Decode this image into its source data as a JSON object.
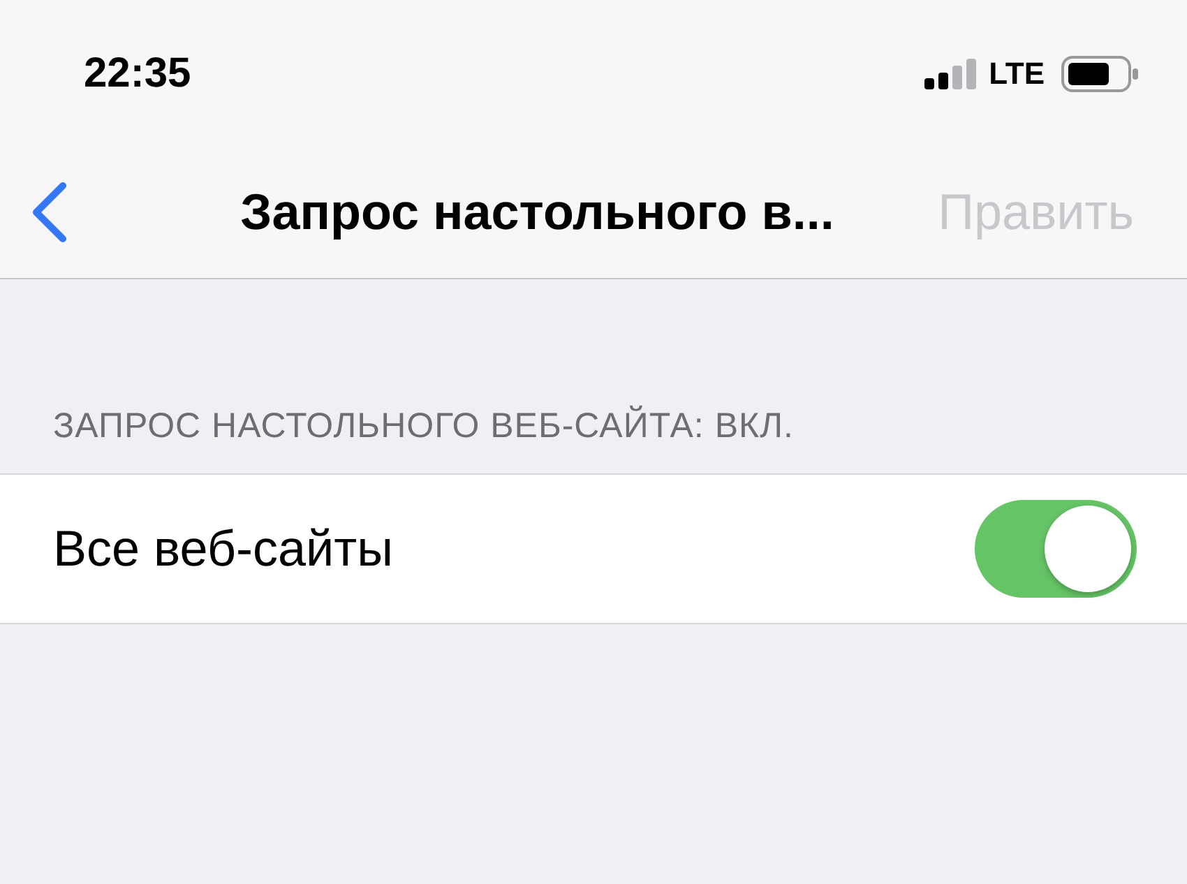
{
  "status_bar": {
    "time": "22:35",
    "network": "LTE"
  },
  "nav_bar": {
    "title": "Запрос настольного в...",
    "action": {
      "label": "Править",
      "disabled": true
    }
  },
  "section": {
    "header": "ЗАПРОС НАСТОЛЬНОГО ВЕБ-САЙТА: ВКЛ.",
    "rows": [
      {
        "label": "Все веб-сайты",
        "on": true
      }
    ]
  }
}
